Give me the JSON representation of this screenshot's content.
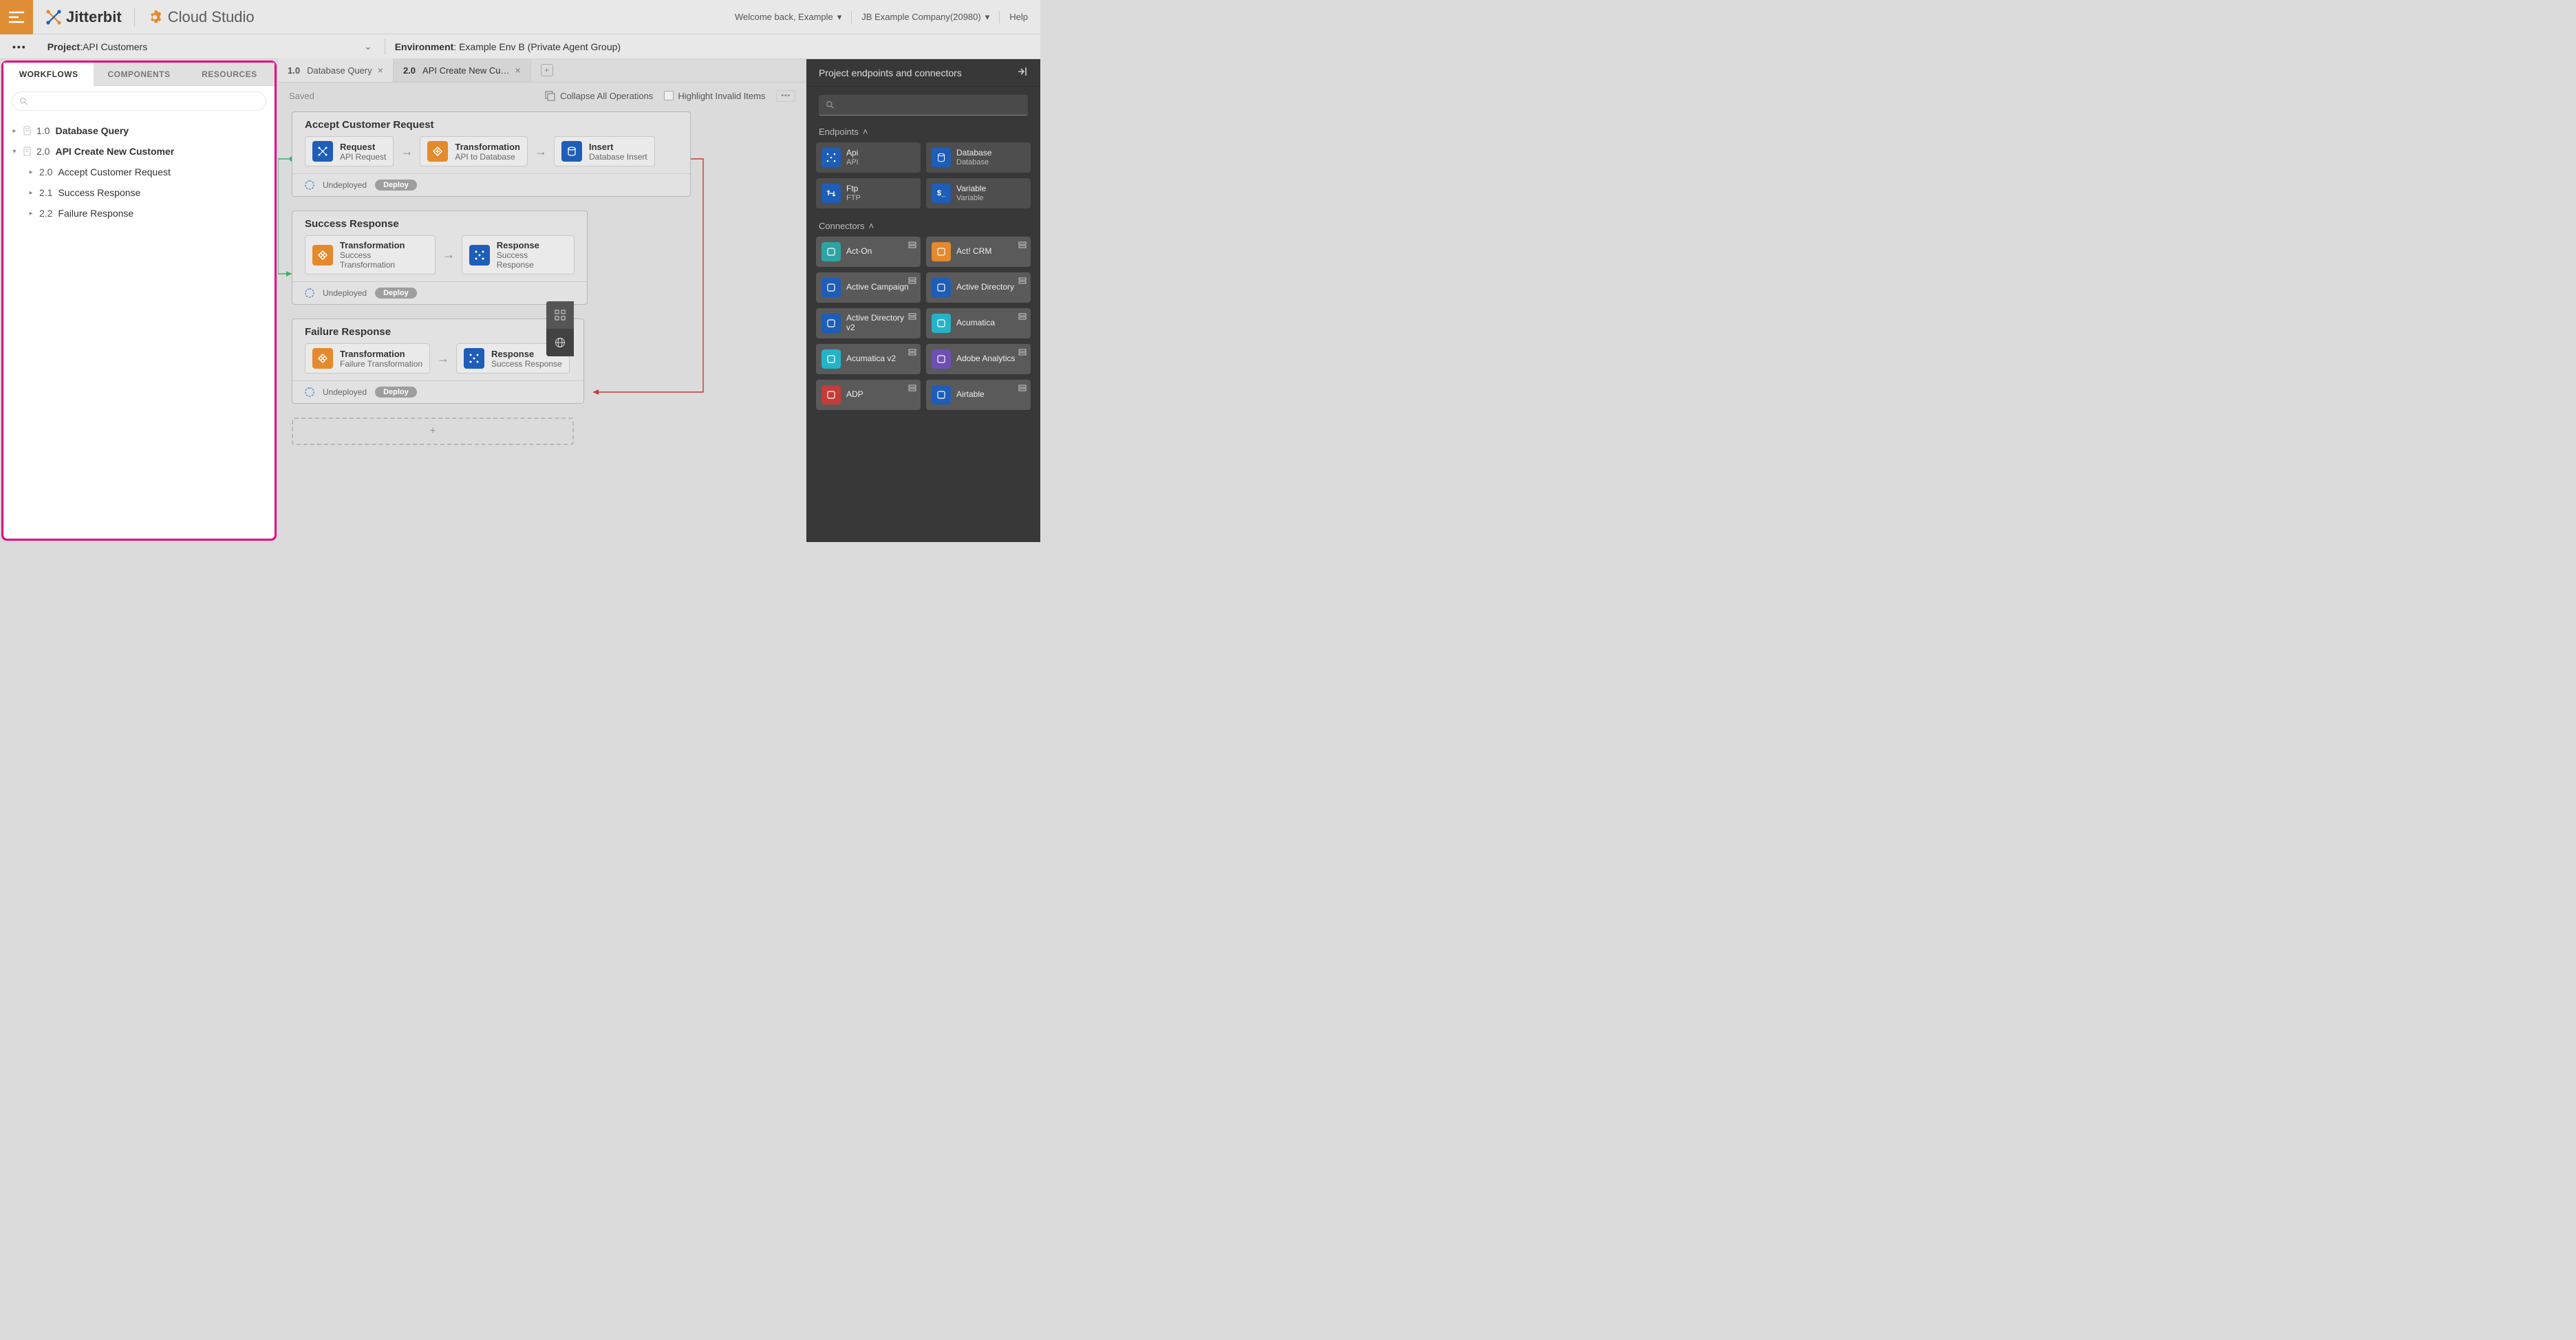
{
  "header": {
    "brand": "Jitterbit",
    "studio": "Cloud Studio",
    "welcome": "Welcome back, Example",
    "company": "JB Example Company(20980)",
    "help": "Help"
  },
  "subheader": {
    "project_label": "Project",
    "project_name": "API Customers",
    "env_label": "Environment",
    "env_name": "Example Env B (Private Agent Group)"
  },
  "pane": {
    "tabs": {
      "workflows": "WORKFLOWS",
      "components": "COMPONENTS",
      "resources": "RESOURCES"
    },
    "tree": [
      {
        "num": "1.0",
        "name": "Database Query",
        "expanded": false
      },
      {
        "num": "2.0",
        "name": "API Create New Customer",
        "expanded": true,
        "children": [
          {
            "num": "2.0",
            "name": "Accept Customer Request"
          },
          {
            "num": "2.1",
            "name": "Success Response"
          },
          {
            "num": "2.2",
            "name": "Failure Response"
          }
        ]
      }
    ]
  },
  "canvas": {
    "tabs": [
      {
        "num": "1.0",
        "name": "Database Query",
        "active": false
      },
      {
        "num": "2.0",
        "name": "API Create New Cu…",
        "active": true
      }
    ],
    "saved": "Saved",
    "collapse": "Collapse All Operations",
    "highlight": "Highlight Invalid Items",
    "ops": [
      {
        "title": "Accept Customer Request",
        "steps": [
          {
            "color": "blue",
            "t1": "Request",
            "t2": "API Request"
          },
          {
            "color": "orange",
            "t1": "Transformation",
            "t2": "API to Database"
          },
          {
            "color": "blue",
            "t1": "Insert",
            "t2": "Database Insert"
          }
        ],
        "status": "Undeployed",
        "deploy": "Deploy"
      },
      {
        "title": "Success Response",
        "steps": [
          {
            "color": "orange",
            "t1": "Transformation",
            "t2": "Success Transformation"
          },
          {
            "color": "blue",
            "t1": "Response",
            "t2": "Success Response"
          }
        ],
        "status": "Undeployed",
        "deploy": "Deploy"
      },
      {
        "title": "Failure Response",
        "steps": [
          {
            "color": "orange",
            "t1": "Transformation",
            "t2": "Failure Transformation"
          },
          {
            "color": "blue",
            "t1": "Response",
            "t2": "Success Response"
          }
        ],
        "status": "Undeployed",
        "deploy": "Deploy"
      }
    ],
    "add": "+"
  },
  "right": {
    "title": "Project endpoints and connectors",
    "endpoints_label": "Endpoints",
    "connectors_label": "Connectors",
    "endpoints": [
      {
        "name": "Api",
        "sub": "API",
        "color": "blue"
      },
      {
        "name": "Database",
        "sub": "Database",
        "color": "blue"
      },
      {
        "name": "Ftp",
        "sub": "FTP",
        "color": "blue"
      },
      {
        "name": "Variable",
        "sub": "Variable",
        "color": "blue"
      }
    ],
    "connectors": [
      {
        "name": "Act-On",
        "color": "teal"
      },
      {
        "name": "Act! CRM",
        "color": "orange"
      },
      {
        "name": "Active Campaign",
        "color": "blue"
      },
      {
        "name": "Active Directory",
        "color": "blue"
      },
      {
        "name": "Active Directory v2",
        "color": "blue"
      },
      {
        "name": "Acumatica",
        "color": "cyan"
      },
      {
        "name": "Acumatica v2",
        "color": "cyan"
      },
      {
        "name": "Adobe Analytics",
        "color": "purple"
      },
      {
        "name": "ADP",
        "color": "red"
      },
      {
        "name": "Airtable",
        "color": "blue"
      }
    ]
  }
}
